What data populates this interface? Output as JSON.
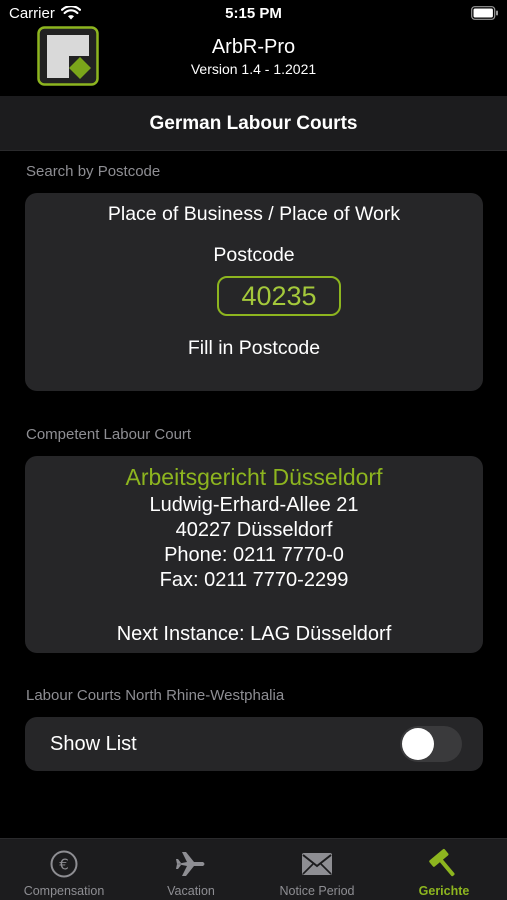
{
  "status_bar": {
    "carrier": "Carrier",
    "time": "5:15 PM"
  },
  "app": {
    "title": "ArbR-Pro",
    "version": "Version 1.4 - 1.2021",
    "logo_icon": "app-logo-icon"
  },
  "nav": {
    "title": "German Labour Courts"
  },
  "search": {
    "section_header": "Search by Postcode",
    "place_label": "Place of Business /  Place of Work",
    "postcode_label": "Postcode",
    "postcode_value": "40235",
    "fill_in_label": "Fill in Postcode"
  },
  "court": {
    "section_header": "Competent Labour Court",
    "name": "Arbeitsgericht Düsseldorf",
    "street": "Ludwig-Erhard-Allee 21",
    "city": "40227 Düsseldorf",
    "phone": "Phone:   0211 7770-0",
    "fax": "Fax:   0211 7770-2299",
    "next_instance": "Next Instance:  LAG Düsseldorf"
  },
  "list": {
    "section_header": "Labour Courts North Rhine-Westphalia",
    "show_list_label": "Show List",
    "show_list_on": false
  },
  "tabs": [
    {
      "label": "Compensation",
      "icon": "euro-coin-icon",
      "active": false
    },
    {
      "label": "Vacation",
      "icon": "airplane-icon",
      "active": false
    },
    {
      "label": "Notice Period",
      "icon": "envelope-icon",
      "active": false
    },
    {
      "label": "Gerichte",
      "icon": "hammer-icon",
      "active": true
    }
  ],
  "colors": {
    "accent": "#8db51f",
    "background": "#000000",
    "card": "#262628",
    "secondary_text": "#8e8e93"
  }
}
